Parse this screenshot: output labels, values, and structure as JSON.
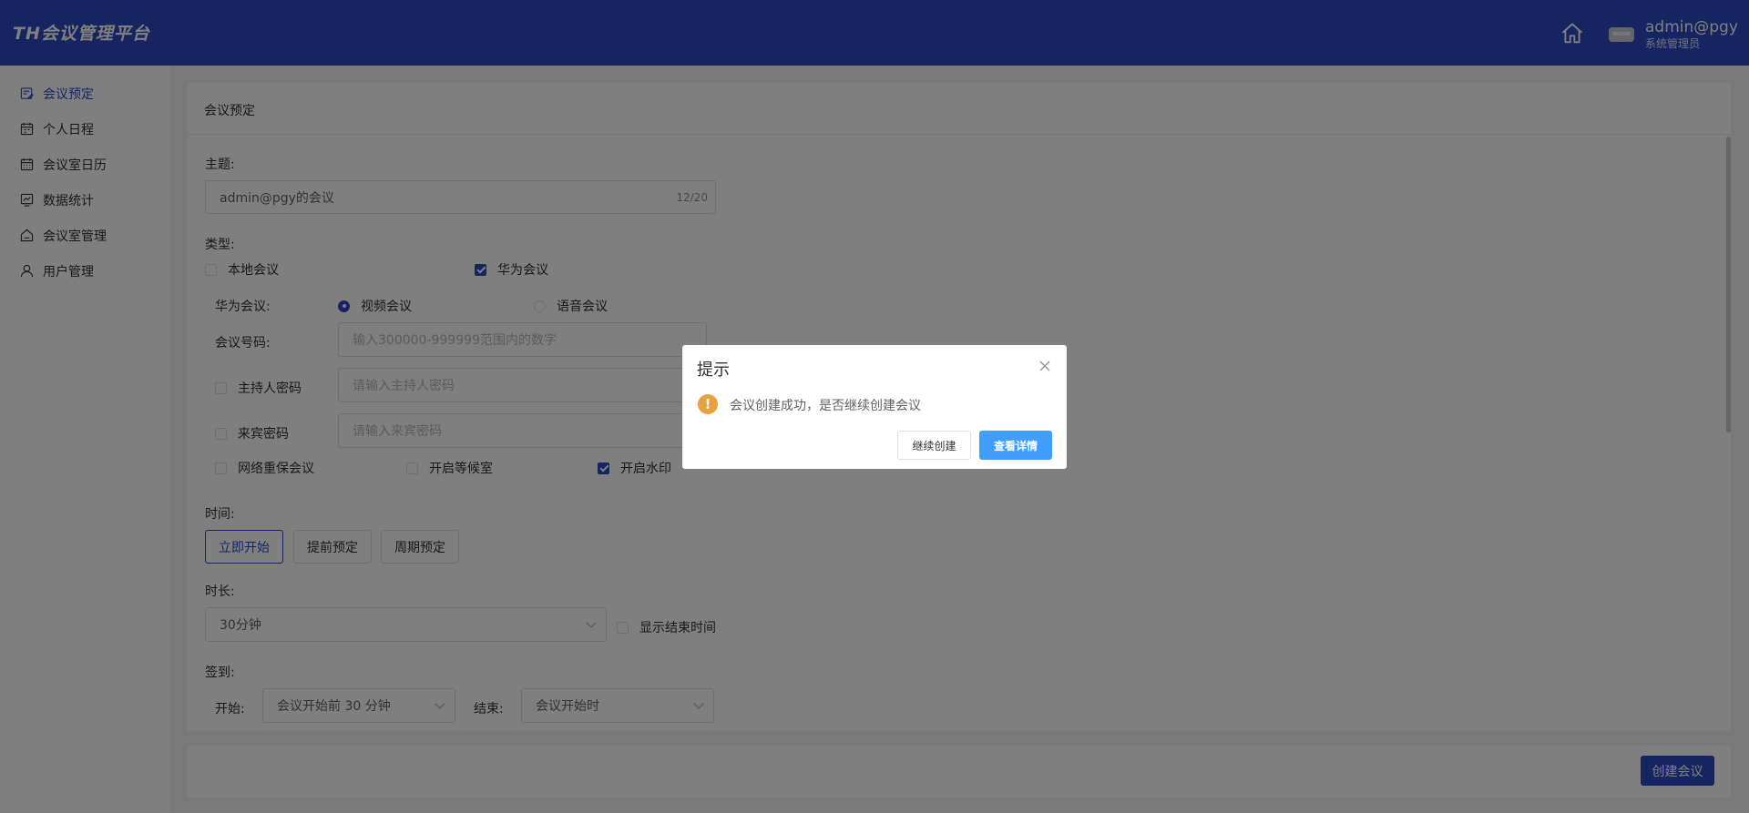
{
  "header": {
    "logo": "TH会议管理平台",
    "user_name": "admin@pgy",
    "user_role": "系统管理员"
  },
  "sidebar": {
    "items": [
      {
        "label": "会议预定",
        "icon": "calendar-edit-icon",
        "active": true
      },
      {
        "label": "个人日程",
        "icon": "schedule-icon",
        "active": false
      },
      {
        "label": "会议室日历",
        "icon": "calendar-icon",
        "active": false
      },
      {
        "label": "数据统计",
        "icon": "chart-icon",
        "active": false
      },
      {
        "label": "会议室管理",
        "icon": "room-icon",
        "active": false
      },
      {
        "label": "用户管理",
        "icon": "user-icon",
        "active": false
      }
    ]
  },
  "main": {
    "title": "会议预定",
    "subject": {
      "label": "主题:",
      "value": "admin@pgy的会议",
      "counter": "12/20"
    },
    "type": {
      "label": "类型:",
      "local_label": "本地会议",
      "huawei_label": "华为会议"
    },
    "huawei": {
      "label": "华为会议:",
      "video_label": "视频会议",
      "voice_label": "语音会议",
      "number_label": "会议号码:",
      "number_placeholder": "输入300000-999999范围内的数字",
      "host_pwd_label": "主持人密码",
      "host_pwd_placeholder": "请输入主持人密码",
      "guest_pwd_label": "来宾密码",
      "guest_pwd_placeholder": "请输入来宾密码",
      "network_label": "网络重保会议",
      "waiting_label": "开启等候室",
      "watermark_label": "开启水印"
    },
    "time": {
      "label": "时间:",
      "now_label": "立即开始",
      "advance_label": "提前预定",
      "period_label": "周期预定"
    },
    "duration": {
      "label": "时长:",
      "value": "30分钟",
      "show_end_label": "显示结束时间"
    },
    "signin": {
      "label": "签到:",
      "start_label": "开始:",
      "start_value": "会议开始前 30 分钟",
      "end_label": "结束:",
      "end_value": "会议开始时"
    },
    "create_label": "创建会议"
  },
  "dialog": {
    "title": "提示",
    "message": "会议创建成功，是否继续创建会议",
    "continue_label": "继续创建",
    "detail_label": "查看详情"
  },
  "colors": {
    "primary": "#2d4bc3",
    "confirm": "#409eff",
    "warning": "#e6a23c"
  }
}
